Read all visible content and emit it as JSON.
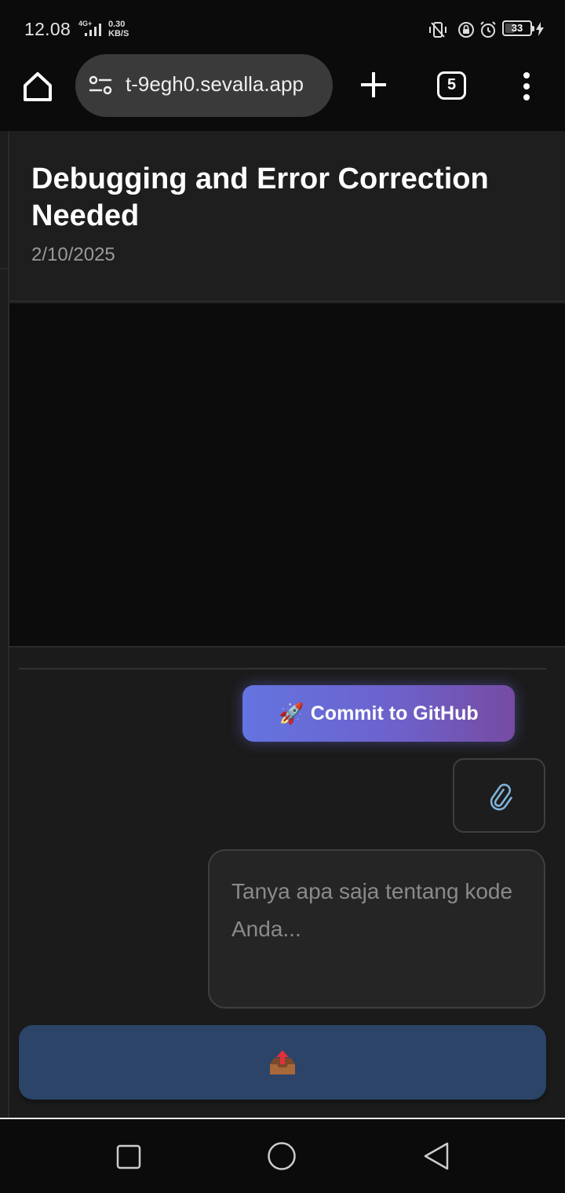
{
  "status_bar": {
    "time": "12.08",
    "network_type": "4G+",
    "net_speed_value": "0.30",
    "net_speed_unit": "KB/S",
    "battery_level": "33",
    "icons": [
      "vibrate-icon",
      "rotation-lock-icon",
      "alarm-icon",
      "battery-icon",
      "charging-icon"
    ]
  },
  "toolbar": {
    "url": "t-9egh0.sevalla.app",
    "tab_count": "5",
    "icons": [
      "home-icon",
      "site-settings-icon",
      "plus-icon",
      "tabs-icon",
      "more-vert-icon"
    ]
  },
  "chat": {
    "title": "Debugging and Error Correction Needed",
    "date": "2/10/2025"
  },
  "composer": {
    "commit_icon": "🚀",
    "commit_label": "Commit to GitHub",
    "attach_icon": "paperclip-icon",
    "input_placeholder": "Tanya apa saja tentang kode Anda...",
    "input_value": "",
    "send_icon": "outbox-icon"
  },
  "nav_bar": {
    "icons": [
      "recents-icon",
      "home-circle-icon",
      "back-icon"
    ]
  },
  "colors": {
    "page_background": "#1a1a1a",
    "commit_gradient_start": "#6474e0",
    "commit_gradient_end": "#764ba2",
    "send_button": "#2b4468"
  }
}
